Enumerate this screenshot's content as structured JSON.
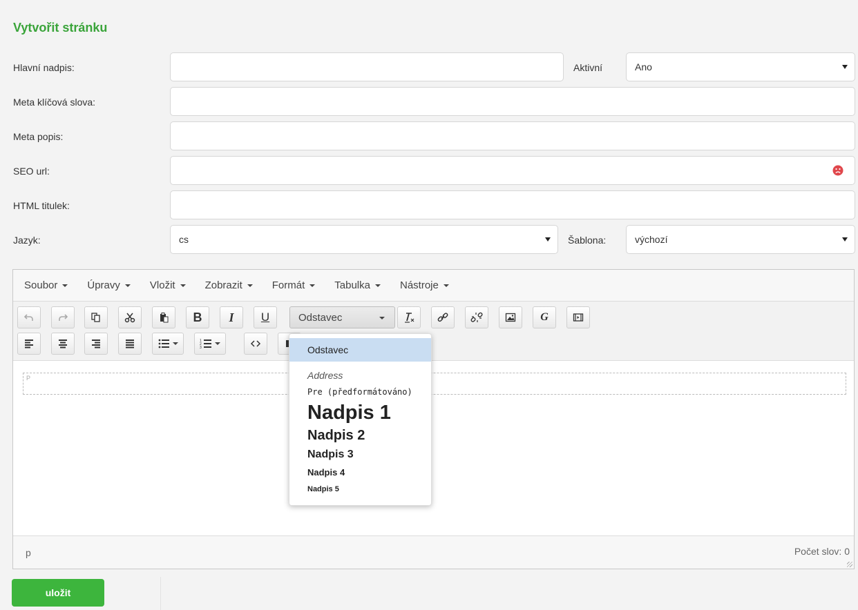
{
  "page": {
    "title": "Vytvořit stránku"
  },
  "form": {
    "main_heading": {
      "label": "Hlavní nadpis:",
      "value": ""
    },
    "active": {
      "label": "Aktivní",
      "value": "Ano"
    },
    "meta_keywords": {
      "label": "Meta klíčová slova:",
      "value": ""
    },
    "meta_description": {
      "label": "Meta popis:",
      "value": ""
    },
    "seo_url": {
      "label": "SEO url:",
      "value": ""
    },
    "html_title": {
      "label": "HTML titulek:",
      "value": ""
    },
    "language": {
      "label": "Jazyk:",
      "value": "cs"
    },
    "template": {
      "label": "Šablona:",
      "value": "výchozí"
    }
  },
  "editor": {
    "menu": [
      "Soubor",
      "Úpravy",
      "Vložit",
      "Zobrazit",
      "Formát",
      "Tabulka",
      "Nástroje"
    ],
    "format_select": "Odstavec",
    "paragraph_mark": "P",
    "status_path": "p",
    "word_count": "Počet slov: 0"
  },
  "format_dropdown": {
    "items": [
      "Odstavec",
      "Address",
      "Pre (předformátováno)",
      "Nadpis 1",
      "Nadpis 2",
      "Nadpis 3",
      "Nadpis 4",
      "Nadpis 5"
    ]
  },
  "toolbar_icons": {
    "bold": "B",
    "italic": "I",
    "underline": "U",
    "google": "G"
  },
  "actions": {
    "save_label": "uložit"
  },
  "colors": {
    "accent": "#3aa43a",
    "save_button": "#3db53d",
    "dropdown_active": "#c9ddf2",
    "error_icon": "#e0474c"
  }
}
